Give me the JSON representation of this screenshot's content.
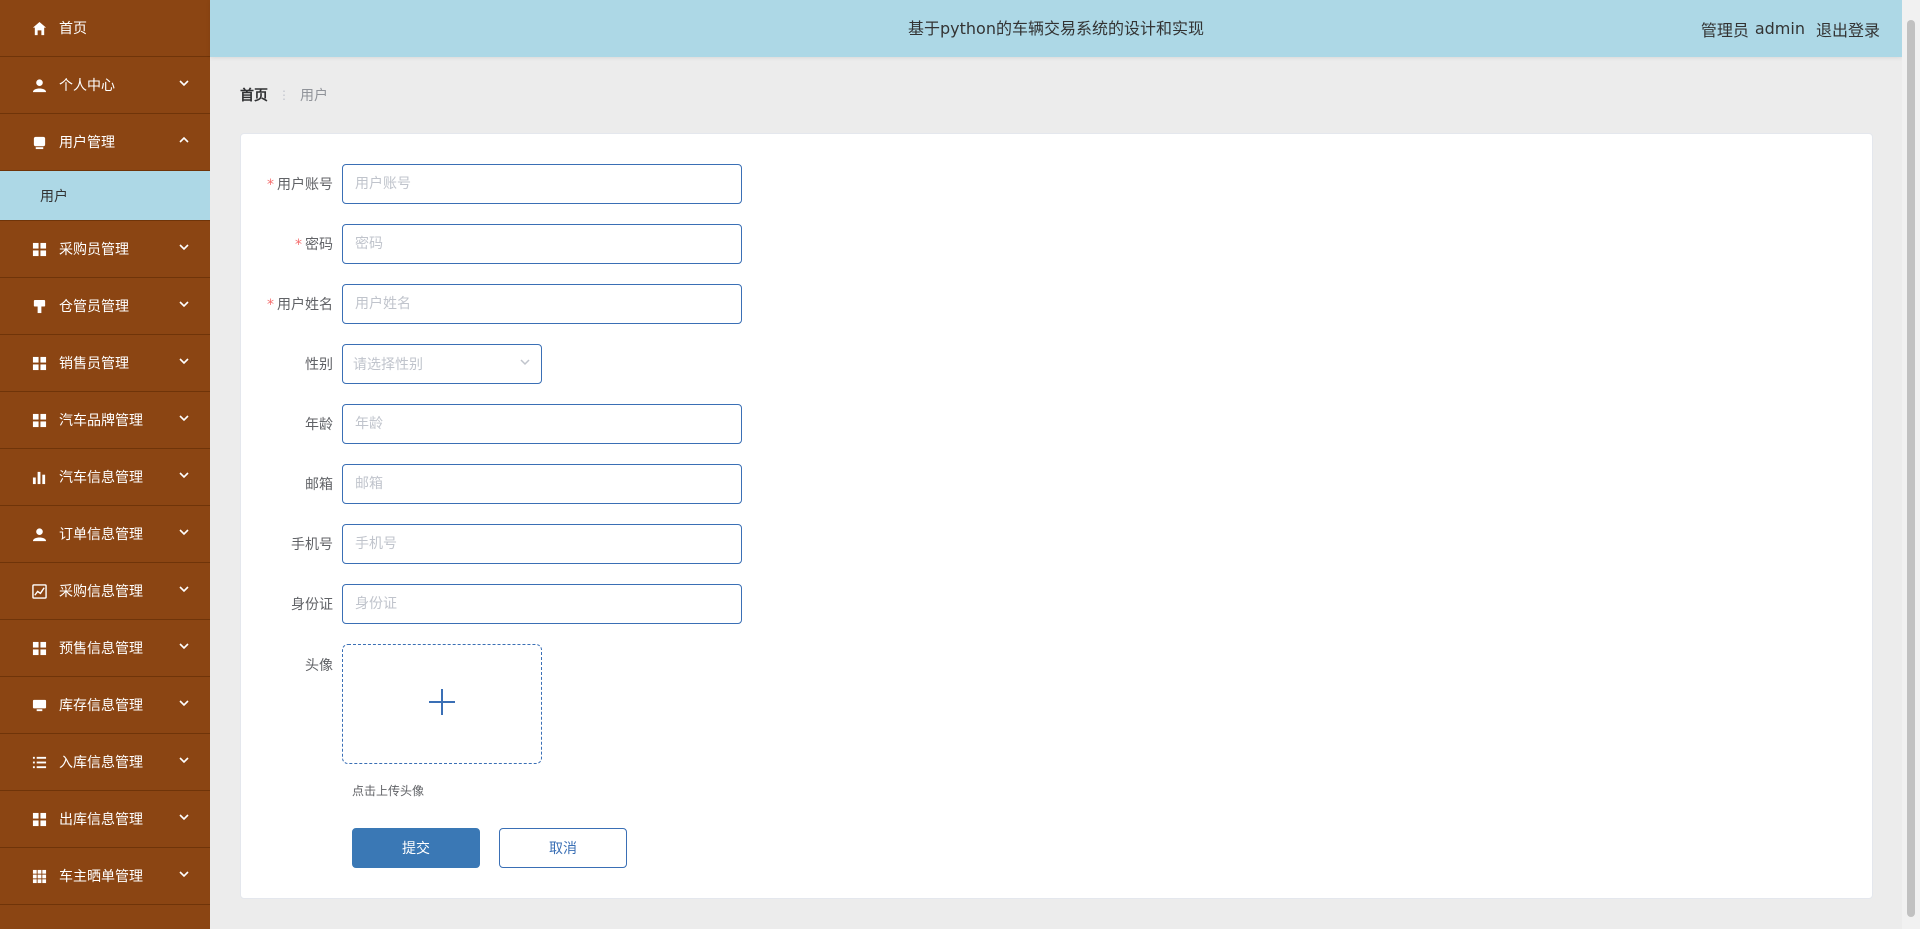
{
  "header": {
    "title": "基于python的车辆交易系统的设计和实现",
    "role": "管理员",
    "username": "admin",
    "logout_label": "退出登录"
  },
  "sidebar": {
    "items": [
      {
        "label": "首页",
        "icon": "home-icon",
        "has_arrow": false
      },
      {
        "label": "个人中心",
        "icon": "user-icon",
        "has_arrow": true,
        "arrow": "down"
      },
      {
        "label": "用户管理",
        "icon": "folder-icon",
        "has_arrow": true,
        "arrow": "up",
        "expanded": true
      },
      {
        "label": "用户",
        "submenu": true,
        "active": true
      },
      {
        "label": "采购员管理",
        "icon": "grid-icon",
        "has_arrow": true,
        "arrow": "down"
      },
      {
        "label": "仓管员管理",
        "icon": "brush-icon",
        "has_arrow": true,
        "arrow": "down"
      },
      {
        "label": "销售员管理",
        "icon": "grid-icon",
        "has_arrow": true,
        "arrow": "down"
      },
      {
        "label": "汽车品牌管理",
        "icon": "grid-icon",
        "has_arrow": true,
        "arrow": "down"
      },
      {
        "label": "汽车信息管理",
        "icon": "bar-chart-icon",
        "has_arrow": true,
        "arrow": "down"
      },
      {
        "label": "订单信息管理",
        "icon": "user-icon",
        "has_arrow": true,
        "arrow": "down"
      },
      {
        "label": "采购信息管理",
        "icon": "line-chart-icon",
        "has_arrow": true,
        "arrow": "down"
      },
      {
        "label": "预售信息管理",
        "icon": "grid-icon",
        "has_arrow": true,
        "arrow": "down"
      },
      {
        "label": "库存信息管理",
        "icon": "monitor-icon",
        "has_arrow": true,
        "arrow": "down"
      },
      {
        "label": "入库信息管理",
        "icon": "list-icon",
        "has_arrow": true,
        "arrow": "down"
      },
      {
        "label": "出库信息管理",
        "icon": "grid-icon",
        "has_arrow": true,
        "arrow": "down"
      },
      {
        "label": "车主晒单管理",
        "icon": "table-icon",
        "has_arrow": true,
        "arrow": "down"
      }
    ]
  },
  "breadcrumb": {
    "home": "首页",
    "separator": "⋮",
    "current": "用户"
  },
  "form": {
    "fields": [
      {
        "label": "用户账号",
        "required": true,
        "placeholder": "用户账号",
        "type": "input"
      },
      {
        "label": "密码",
        "required": true,
        "placeholder": "密码",
        "type": "input"
      },
      {
        "label": "用户姓名",
        "required": true,
        "placeholder": "用户姓名",
        "type": "input"
      },
      {
        "label": "性别",
        "required": false,
        "placeholder": "请选择性别",
        "type": "select"
      },
      {
        "label": "年龄",
        "required": false,
        "placeholder": "年龄",
        "type": "input"
      },
      {
        "label": "邮箱",
        "required": false,
        "placeholder": "邮箱",
        "type": "input"
      },
      {
        "label": "手机号",
        "required": false,
        "placeholder": "手机号",
        "type": "input"
      },
      {
        "label": "身份证",
        "required": false,
        "placeholder": "身份证",
        "type": "input"
      }
    ],
    "avatar_label": "头像",
    "upload_tip": "点击上传头像",
    "submit_label": "提交",
    "cancel_label": "取消",
    "required_mark": "*"
  },
  "colors": {
    "sidebar_bg": "#8b4513",
    "header_bg": "#add8e6",
    "active_submenu_bg": "#add8e6",
    "primary": "#3a78b5",
    "required": "#f56c6c"
  }
}
